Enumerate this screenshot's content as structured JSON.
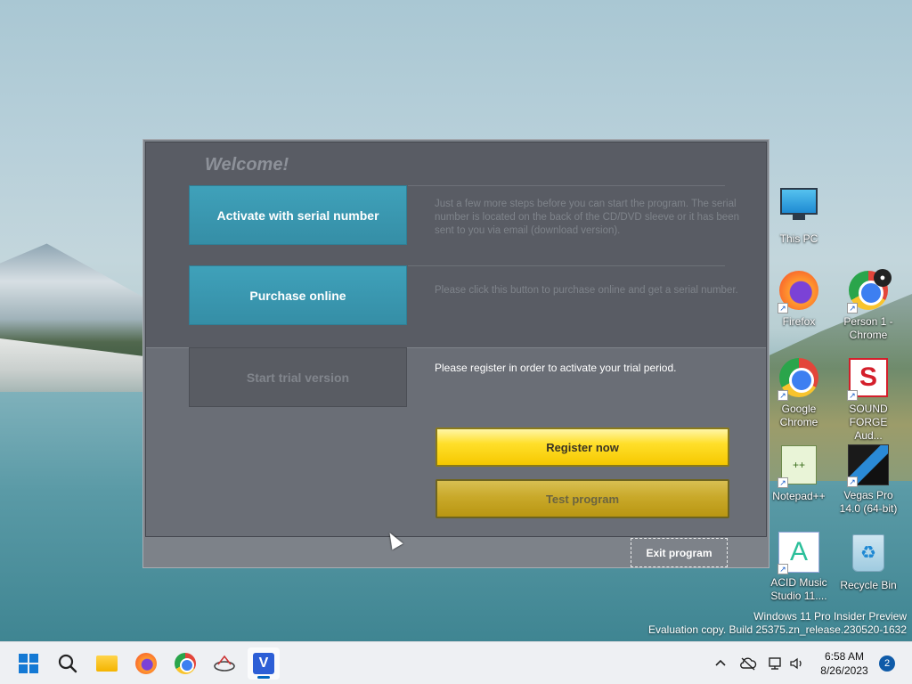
{
  "dialog": {
    "welcome": "Welcome!",
    "activate_label": "Activate with serial number",
    "activate_desc": "Just a few more steps before you can start the program. The serial number is located on the back of the CD/DVD sleeve or it has been sent to you via email (download version).",
    "purchase_label": "Purchase online",
    "purchase_desc": "Please click this button to purchase online and get a serial number.",
    "trial_label": "Start trial version",
    "trial_desc": "Please register in order to activate your trial period.",
    "register_label": "Register now",
    "test_label": "Test program",
    "exit_label": "Exit program"
  },
  "desktop_icons": [
    {
      "label": "This PC",
      "icon": "monitor-icon"
    },
    {
      "label": "Firefox",
      "icon": "firefox-icon"
    },
    {
      "label": "Person 1 - Chrome",
      "icon": "chrome-icon"
    },
    {
      "label": "Google Chrome",
      "icon": "chrome-icon"
    },
    {
      "label": "SOUND FORGE Aud...",
      "icon": "sound-forge-icon"
    },
    {
      "label": "Notepad++",
      "icon": "notepad-plus-plus-icon"
    },
    {
      "label": "Vegas Pro 14.0 (64-bit)",
      "icon": "vegas-pro-icon"
    },
    {
      "label": "ACID Music Studio 11....",
      "icon": "acid-music-icon"
    },
    {
      "label": "Recycle Bin",
      "icon": "recycle-bin-icon"
    }
  ],
  "watermark": {
    "line1": "Windows 11 Pro Insider Preview",
    "line2": "Evaluation copy. Build 25375.zn_release.230520-1632"
  },
  "taskbar": {
    "apps": [
      "start-icon",
      "search-icon",
      "file-explorer-icon",
      "firefox-icon",
      "chrome-icon",
      "network-tool-icon",
      "vegas-pro-icon"
    ],
    "time": "6:58 AM",
    "date": "8/26/2023",
    "notification_count": "2"
  },
  "colors": {
    "accent_blue": "#3fa1ba",
    "register_yellow": "#ffdf2a",
    "dialog_bg": "#595c64"
  }
}
